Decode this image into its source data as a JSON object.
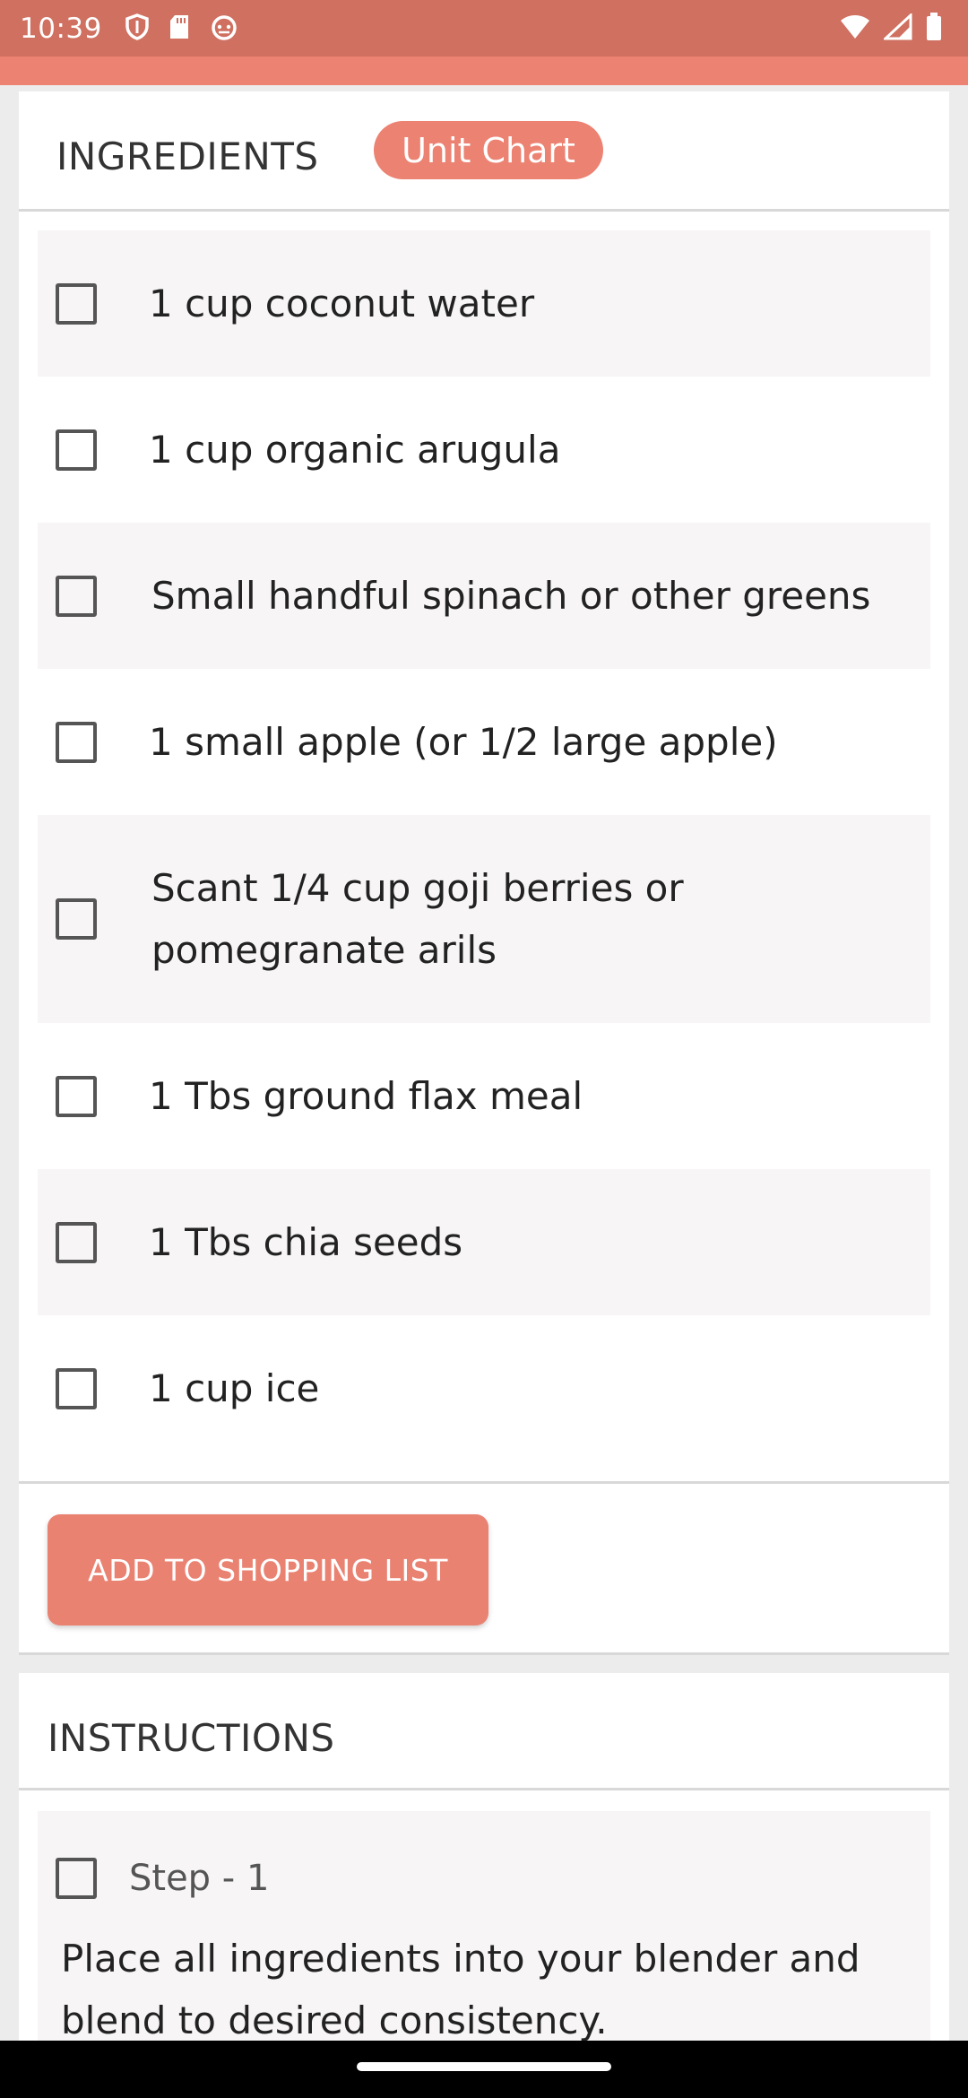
{
  "status_bar": {
    "time": "10:39",
    "left_icons": [
      "shield-icon",
      "sd-card-icon",
      "android-debug-icon"
    ],
    "right_icons": [
      "wifi-icon",
      "signal-icon",
      "battery-icon"
    ]
  },
  "ingredients": {
    "title": "INGREDIENTS",
    "unit_chart_label": "Unit Chart",
    "items": [
      {
        "text": "1 cup coconut water"
      },
      {
        "text": "1 cup organic arugula"
      },
      {
        "text": "Small handful spinach or other greens"
      },
      {
        "text": "1 small apple (or 1/2 large apple)"
      },
      {
        "text": "Scant 1/4 cup goji berries or pomegranate arils"
      },
      {
        "text": "1 Tbs ground flax meal"
      },
      {
        "text": "1 Tbs chia seeds"
      },
      {
        "text": "1 cup ice"
      }
    ],
    "add_button_label": "ADD TO SHOPPING LIST"
  },
  "instructions": {
    "title": "INSTRUCTIONS",
    "steps": [
      {
        "label": "Step - 1",
        "text": "Place all ingredients into your blender and blend to desired consistency."
      }
    ]
  },
  "colors": {
    "status_bar": "#cf7060",
    "accent": "#ec8272",
    "row_shade": "#f7f5f5"
  }
}
